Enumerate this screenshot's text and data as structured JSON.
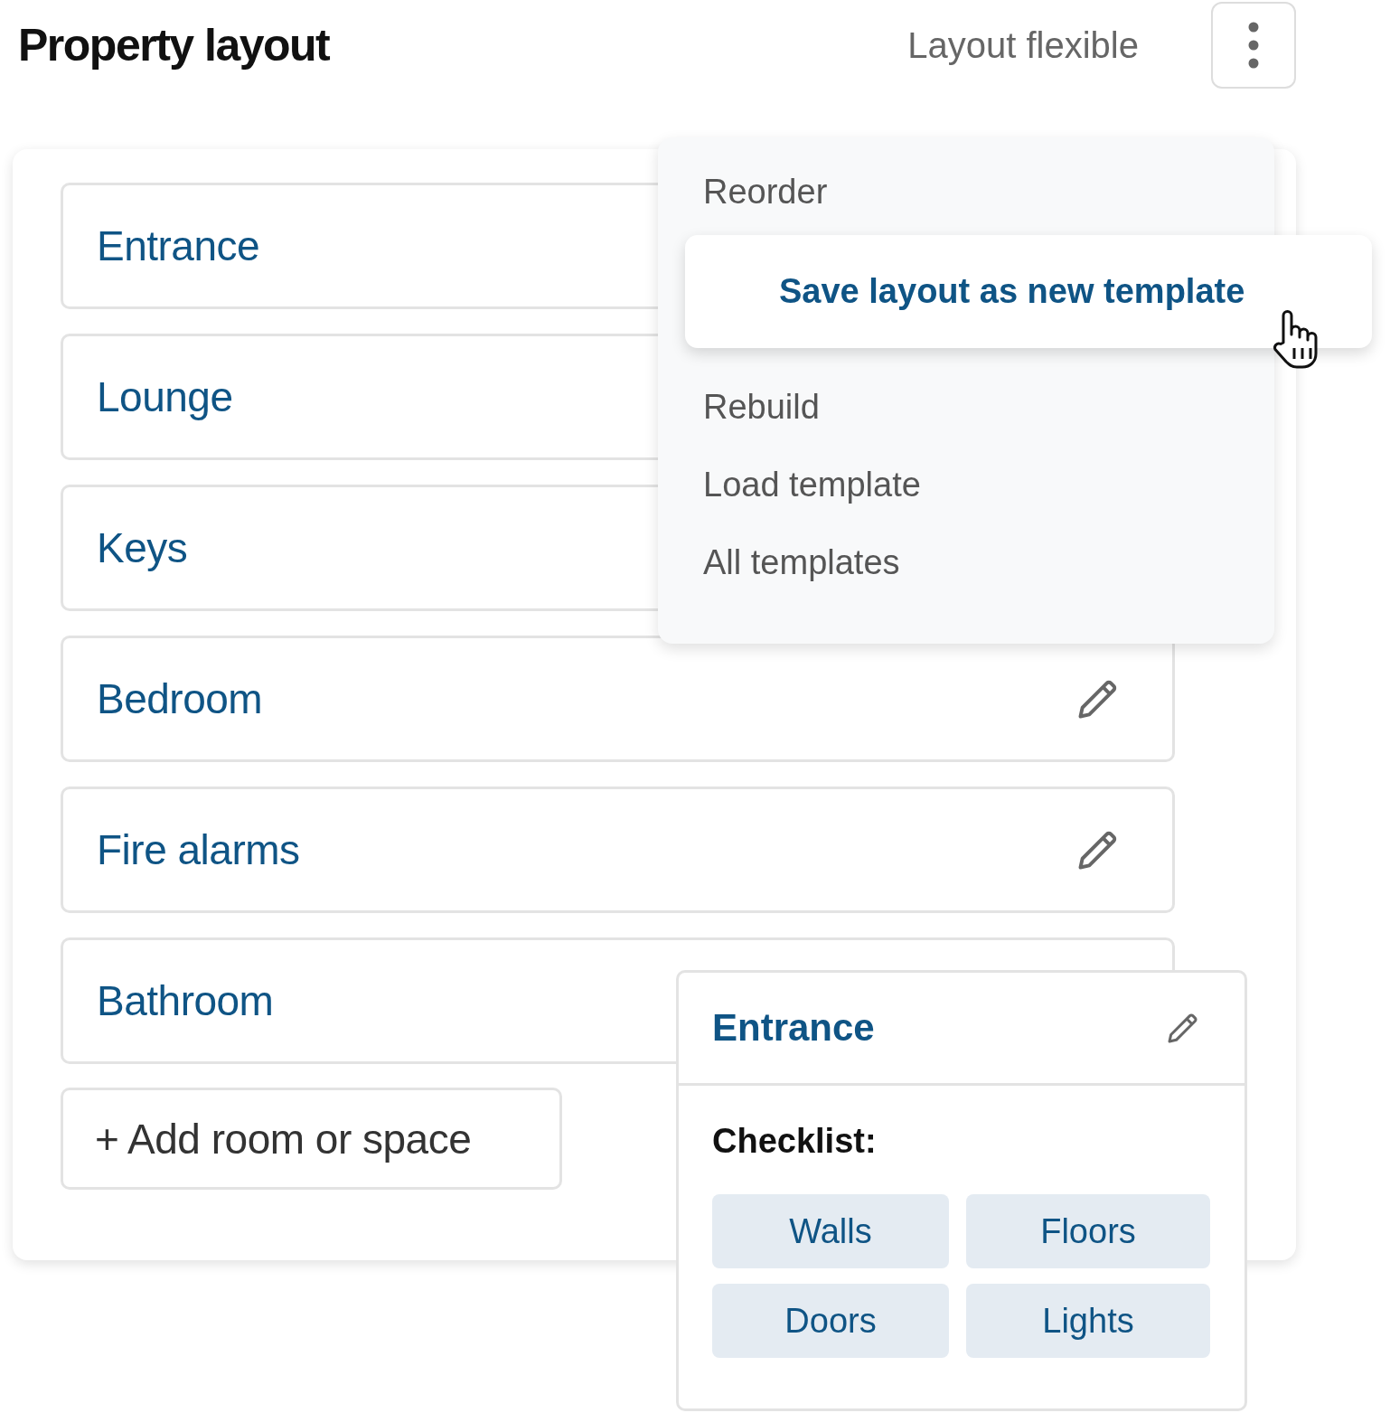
{
  "header": {
    "title": "Property layout",
    "status": "Layout flexible"
  },
  "rooms": [
    {
      "name": "Entrance"
    },
    {
      "name": "Lounge"
    },
    {
      "name": "Keys"
    },
    {
      "name": "Bedroom",
      "edit_icon": true
    },
    {
      "name": "Fire alarms",
      "edit_icon": true
    },
    {
      "name": "Bathroom"
    }
  ],
  "add_button": "+ Add room or space",
  "menu": [
    {
      "label": "Reorder",
      "selected": false
    },
    {
      "label": "Save layout as new template",
      "selected": true
    },
    {
      "label": "Rebuild",
      "selected": false
    },
    {
      "label": "Load template",
      "selected": false
    },
    {
      "label": "All templates",
      "selected": false
    }
  ],
  "detail": {
    "title": "Entrance",
    "checklist_label": "Checklist:",
    "items": [
      "Walls",
      "Floors",
      "Doors",
      "Lights"
    ]
  }
}
